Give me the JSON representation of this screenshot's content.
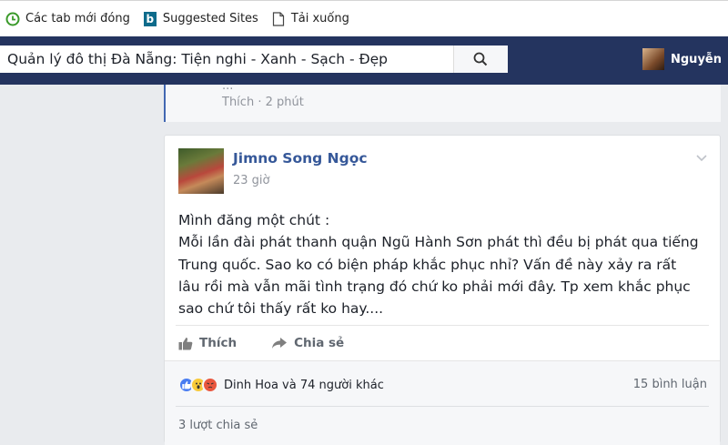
{
  "bookmarks": [
    {
      "label": "Các tab mới đóng",
      "icon": "history-icon"
    },
    {
      "label": "Suggested Sites",
      "icon": "bing-icon"
    },
    {
      "label": "Tải xuống",
      "icon": "file-icon"
    }
  ],
  "header": {
    "search_value": "Quản lý đô thị Đà Nẵng: Tiện nghi - Xanh - Sạch - Đẹp",
    "user_name": "Nguyễn",
    "colors": {
      "bar": "#24345f",
      "link": "#365899"
    }
  },
  "previous_comment": {
    "partial_text": "...",
    "like_label": "Thích",
    "time": "2 phút"
  },
  "post": {
    "author": "Jimno Song Ngọc",
    "time": "23 giờ",
    "text_lines": [
      "Mình đăng một chút :",
      "Mỗi lần đài phát thanh quận Ngũ Hành Sơn phát thì đều bị phát qua tiếng",
      "Trung quốc. Sao ko có biện pháp khắc phục nhỉ? Vấn đề này xảy ra rất",
      "lâu rồi mà vẫn mãi tình trạng đó chứ ko phải mới đây. Tp xem khắc phục",
      "sao chứ tôi thấy rất ko hay...."
    ],
    "like_label": "Thích",
    "share_label": "Chia sẻ",
    "reactions_label": "Dinh Hoa và 74 người khác",
    "comments_label": "15 bình luận",
    "shares_label": "3 lượt chia sẻ"
  }
}
